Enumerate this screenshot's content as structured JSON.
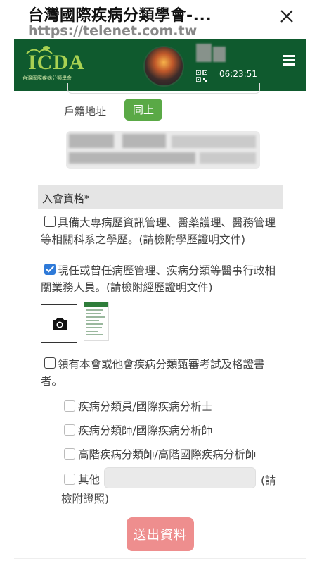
{
  "browser": {
    "page_title": "台灣國際疾病分類學會-...",
    "url": "https://telenet.com.tw",
    "close_icon": "close-icon"
  },
  "header": {
    "logo_text": "ICDA",
    "logo_subtitle": "台灣國際疾病分類學會",
    "time": "06:23:51",
    "qr_icon": "qr-code-icon",
    "menu_icon": "hamburger-menu-icon",
    "brand_color": "#0f5a2e"
  },
  "form": {
    "household_label": "戶籍地址",
    "same_button": "同上",
    "section_title": "入會資格*",
    "q1": {
      "checked": false,
      "text": "具備大專病歷資訊管理、醫藥護理、醫務管理等相關科系之學歷。(請檢附學歷證明文件)"
    },
    "q2": {
      "checked": true,
      "text": "現任或曾任病歷管理、疾病分類等醫事行政相關業務人員。(請檢附經歷證明文件)"
    },
    "upload_icon": "camera-icon",
    "q3": {
      "checked": false,
      "text": "領有本會或他會疾病分類甄審考試及格證書者。",
      "options": [
        {
          "label": "疾病分類員/國際疾病分析士",
          "checked": false
        },
        {
          "label": "疾病分類師/國際疾病分析師",
          "checked": false
        },
        {
          "label": "高階疾病分類師/高階國際疾病分析師",
          "checked": false
        }
      ],
      "other_label": "其他",
      "other_value": "",
      "other_suffix_1": "(請",
      "other_suffix_2": "檢附證照)"
    },
    "submit_label": "送出資料",
    "submit_color": "#ee8e8e"
  }
}
